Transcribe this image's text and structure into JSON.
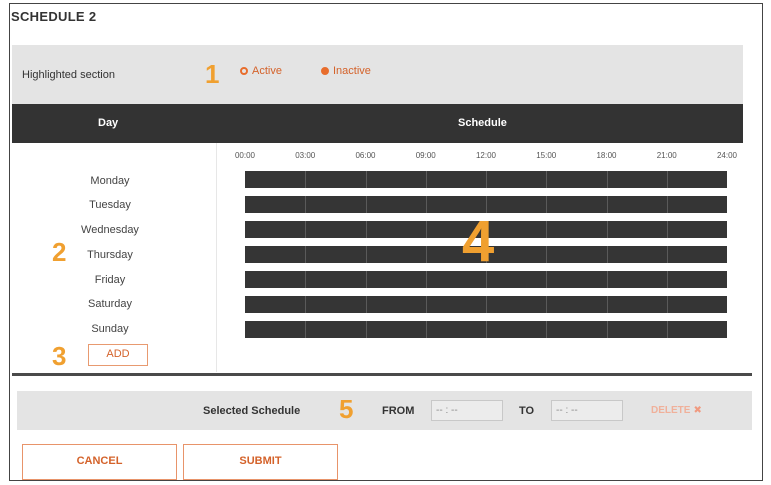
{
  "title": "SCHEDULE 2",
  "highlight": {
    "label": "Highlighted section",
    "callout": "1",
    "radios": [
      {
        "label": "Active",
        "selected": false
      },
      {
        "label": "Inactive",
        "selected": true
      }
    ]
  },
  "table": {
    "header_day": "Day",
    "header_schedule": "Schedule",
    "hours": [
      "00:00",
      "03:00",
      "06:00",
      "09:00",
      "12:00",
      "15:00",
      "18:00",
      "21:00",
      "24:00"
    ],
    "days": [
      "Monday",
      "Tuesday",
      "Wednesday",
      "Thursday",
      "Friday",
      "Saturday",
      "Sunday"
    ],
    "days_callout": "2",
    "grid_callout": "4"
  },
  "add": {
    "label": "ADD",
    "callout": "3"
  },
  "selection": {
    "label": "Selected Schedule",
    "callout": "5",
    "from_label": "FROM",
    "from_value": "-- : --",
    "to_label": "TO",
    "to_value": "-- : --",
    "delete_label": "DELETE"
  },
  "buttons": {
    "cancel": "CANCEL",
    "submit": "SUBMIT"
  },
  "colors": {
    "accent": "#e86d2c",
    "callout": "#f0a030",
    "header_bg": "#333333",
    "bar": "#353535"
  }
}
